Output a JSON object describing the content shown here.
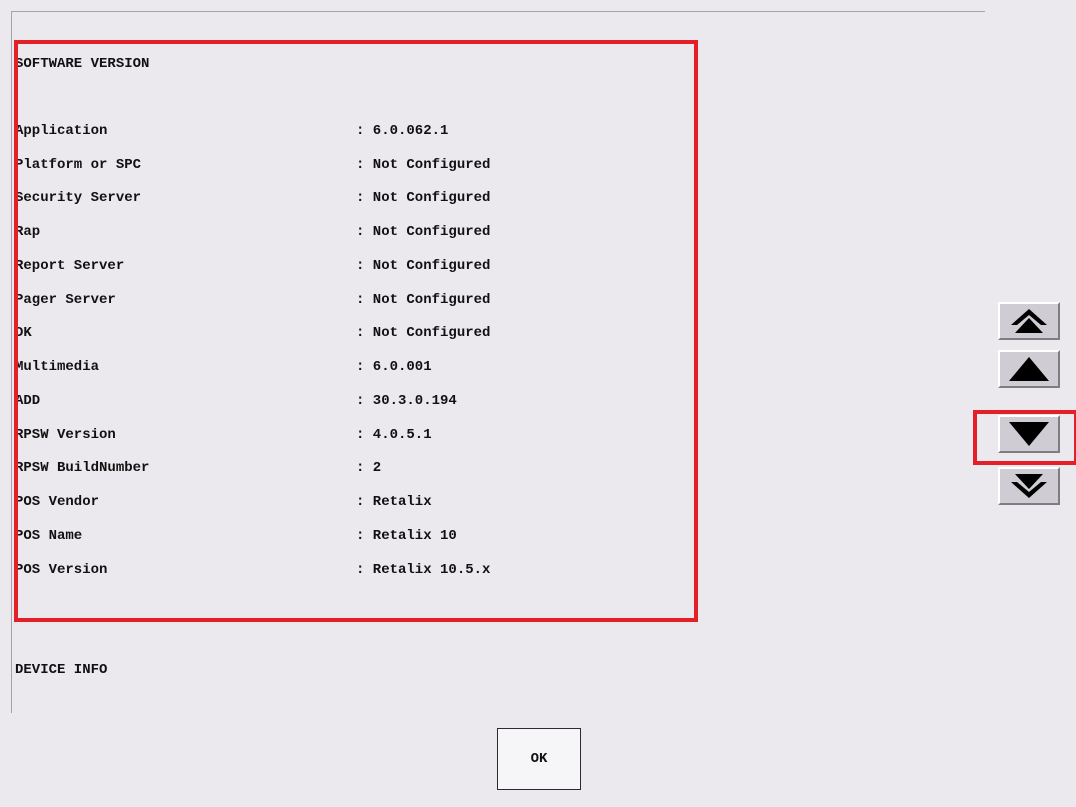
{
  "software_section": {
    "title": "SOFTWARE VERSION",
    "rows": [
      {
        "label": "Application",
        "value": ": 6.0.062.1"
      },
      {
        "label": "Platform or SPC",
        "value": ": Not Configured"
      },
      {
        "label": "Security Server",
        "value": ": Not Configured"
      },
      {
        "label": "Rap",
        "value": ": Not Configured"
      },
      {
        "label": "Report Server",
        "value": ": Not Configured"
      },
      {
        "label": "Pager Server",
        "value": ": Not Configured"
      },
      {
        "label": "DK",
        "value": ": Not Configured"
      },
      {
        "label": "Multimedia",
        "value": ": 6.0.001"
      },
      {
        "label": "ADD",
        "value": ": 30.3.0.194"
      },
      {
        "label": "RPSW Version",
        "value": ": 4.0.5.1"
      },
      {
        "label": "RPSW BuildNumber",
        "value": ": 2"
      },
      {
        "label": "POS Vendor",
        "value": ": Retalix"
      },
      {
        "label": "POS Name",
        "value": ": Retalix 10"
      },
      {
        "label": "POS Version",
        "value": ": Retalix 10.5.x"
      }
    ]
  },
  "device_section": {
    "title": "DEVICE INFO"
  },
  "scroll_buttons": [
    {
      "icon": "double-up-arrow-icon"
    },
    {
      "icon": "up-arrow-icon"
    },
    {
      "icon": "down-arrow-icon"
    },
    {
      "icon": "double-down-arrow-icon"
    }
  ],
  "ok_button": {
    "label": "OK"
  },
  "colors": {
    "highlight": "#e32028",
    "background": "#ebe9ee",
    "button_face": "#cfcdd3"
  }
}
